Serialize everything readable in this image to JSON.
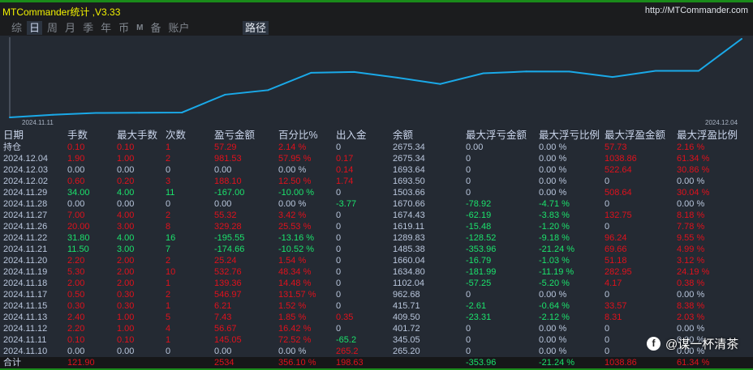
{
  "app": {
    "title": "MTCommander统计 ,V3.33",
    "url": "http://MTCommander.com"
  },
  "tabs": [
    {
      "label": "综",
      "selected": false
    },
    {
      "label": "日",
      "selected": true
    },
    {
      "label": "周",
      "selected": false
    },
    {
      "label": "月",
      "selected": false
    },
    {
      "label": "季",
      "selected": false
    },
    {
      "label": "年",
      "selected": false
    },
    {
      "label": "币",
      "selected": false
    },
    {
      "label": "M",
      "selected": false
    },
    {
      "label": "备",
      "selected": false
    },
    {
      "label": "账户",
      "selected": false
    }
  ],
  "path_button": "路径",
  "chart_data": {
    "type": "line",
    "x_start_label": "2024.11.11",
    "x_end_label": "2024.12.04",
    "line_color": "#1aa9e8",
    "x": [
      "2024.11.10",
      "2024.11.11",
      "2024.11.12",
      "2024.11.13",
      "2024.11.15",
      "2024.11.17",
      "2024.11.18",
      "2024.11.19",
      "2024.11.20",
      "2024.11.21",
      "2024.11.22",
      "2024.11.26",
      "2024.11.27",
      "2024.11.28",
      "2024.11.29",
      "2024.12.02",
      "2024.12.03",
      "2024.12.04"
    ],
    "values": [
      265.2,
      345.05,
      401.72,
      409.5,
      415.71,
      962.68,
      1102.04,
      1634.8,
      1660.04,
      1485.38,
      1289.83,
      1619.11,
      1674.43,
      1670.66,
      1503.66,
      1693.5,
      1693.64,
      2675.34
    ]
  },
  "colors": {
    "red": "#e0111c",
    "green": "#1be36c",
    "neutral": "#b9c6dc"
  },
  "table": {
    "headers": [
      "日期",
      "手数",
      "最大手数",
      "次数",
      "盈亏金额",
      "百分比%",
      "出入金",
      "余额",
      "最大浮亏金额",
      "最大浮亏比例",
      "最大浮盈金额",
      "最大浮盈比例"
    ],
    "rows": [
      {
        "c": "wrrrrrnnnnrr",
        "v": [
          "持仓",
          "0.10",
          "0.10",
          "1",
          "57.29",
          "2.14 %",
          "0",
          "2675.34",
          "0.00",
          "0.00 %",
          "57.73",
          "2.16 %"
        ]
      },
      {
        "c": "nrrrrrrnnnrr",
        "v": [
          "2024.12.04",
          "1.90",
          "1.00",
          "2",
          "981.53",
          "57.95 %",
          "0.17",
          "2675.34",
          "0",
          "0.00 %",
          "1038.86",
          "61.34 %"
        ]
      },
      {
        "c": "nnnnnnrnnnrr",
        "v": [
          "2024.12.03",
          "0.00",
          "0.00",
          "0",
          "0.00",
          "0.00 %",
          "0.14",
          "1693.64",
          "0",
          "0.00 %",
          "522.64",
          "30.86 %"
        ]
      },
      {
        "c": "nrrrrrrnnnnn",
        "v": [
          "2024.12.02",
          "0.60",
          "0.20",
          "3",
          "188.10",
          "12.50 %",
          "1.74",
          "1693.50",
          "0",
          "0.00 %",
          "0",
          "0.00 %"
        ]
      },
      {
        "c": "nggggg nnnnrr",
        "v": [
          "2024.11.29",
          "34.00",
          "4.00",
          "11",
          "-167.00",
          "-10.00 %",
          "0",
          "1503.66",
          "0",
          "0.00 %",
          "508.64",
          "30.04 %"
        ]
      },
      {
        "c": "nnnnnngnggnn",
        "v": [
          "2024.11.28",
          "0.00",
          "0.00",
          "0",
          "0.00",
          "0.00 %",
          "-3.77",
          "1670.66",
          "-78.92",
          "-4.71 %",
          "0",
          "0.00 %"
        ]
      },
      {
        "c": "nrrrrrnnggrr",
        "v": [
          "2024.11.27",
          "7.00",
          "4.00",
          "2",
          "55.32",
          "3.42 %",
          "0",
          "1674.43",
          "-62.19",
          "-3.83 %",
          "132.75",
          "8.18 %"
        ]
      },
      {
        "c": "nrrrrrnnggnr",
        "v": [
          "2024.11.26",
          "20.00",
          "3.00",
          "8",
          "329.28",
          "25.53 %",
          "0",
          "1619.11",
          "-15.48",
          "-1.20 %",
          "0",
          "7.78 %"
        ]
      },
      {
        "c": "ngggggnnggrr",
        "v": [
          "2024.11.22",
          "31.80",
          "4.00",
          "16",
          "-195.55",
          "-13.16 %",
          "0",
          "1289.83",
          "-128.52",
          "-9.18 %",
          "96.24",
          "9.55 %"
        ]
      },
      {
        "c": "ngggggnnggrr",
        "v": [
          "2024.11.21",
          "11.50",
          "3.00",
          "7",
          "-174.66",
          "-10.52 %",
          "0",
          "1485.38",
          "-353.96",
          "-21.24 %",
          "69.66",
          "4.99 %"
        ]
      },
      {
        "c": "nrrrrrnnggrr",
        "v": [
          "2024.11.20",
          "2.20",
          "2.00",
          "2",
          "25.24",
          "1.54 %",
          "0",
          "1660.04",
          "-16.79",
          "-1.03 %",
          "51.18",
          "3.12 %"
        ]
      },
      {
        "c": "nrrrrrnnggrr",
        "v": [
          "2024.11.19",
          "5.30",
          "2.00",
          "10",
          "532.76",
          "48.34 %",
          "0",
          "1634.80",
          "-181.99",
          "-11.19 %",
          "282.95",
          "24.19 %"
        ]
      },
      {
        "c": "nrrrrrnnggrr",
        "v": [
          "2024.11.18",
          "2.00",
          "2.00",
          "1",
          "139.36",
          "14.48 %",
          "0",
          "1102.04",
          "-57.25",
          "-5.20 %",
          "4.17",
          "0.38 %"
        ]
      },
      {
        "c": "nrrrrrnnnnnn",
        "v": [
          "2024.11.17",
          "0.50",
          "0.30",
          "2",
          "546.97",
          "131.57 %",
          "0",
          "962.68",
          "0",
          "0.00 %",
          "0",
          "0.00 %"
        ]
      },
      {
        "c": "nrrrrrnnggrr",
        "v": [
          "2024.11.15",
          "0.30",
          "0.30",
          "1",
          "6.21",
          "1.52 %",
          "0",
          "415.71",
          "-2.61",
          "-0.64 %",
          "33.57",
          "8.38 %"
        ]
      },
      {
        "c": "nrrrrrrnggrr",
        "v": [
          "2024.11.13",
          "2.40",
          "1.00",
          "5",
          "7.43",
          "1.85 %",
          "0.35",
          "409.50",
          "-23.31",
          "-2.12 %",
          "8.31",
          "2.03 %"
        ]
      },
      {
        "c": "nrrrrrnnnnnn",
        "v": [
          "2024.11.12",
          "2.20",
          "1.00",
          "4",
          "56.67",
          "16.42 %",
          "0",
          "401.72",
          "0",
          "0.00 %",
          "0",
          "0.00 %"
        ]
      },
      {
        "c": "nrrrrrgnnnnn",
        "v": [
          "2024.11.11",
          "0.10",
          "0.10",
          "1",
          "145.05",
          "72.52 %",
          "-65.2",
          "345.05",
          "0",
          "0.00 %",
          "0",
          "0.00 %"
        ]
      },
      {
        "c": "nnnnnnrnnnnn",
        "v": [
          "2024.11.10",
          "0.00",
          "0.00",
          "0",
          "0.00",
          "0.00 %",
          "265.2",
          "265.20",
          "0",
          "0.00 %",
          "0",
          "0.00 %"
        ]
      }
    ],
    "total": {
      "c": "wrnnrrrnggrr",
      "v": [
        "合计",
        "121.90",
        "",
        "",
        "2534",
        "356.10 %",
        "198.63",
        "",
        "-353.96",
        "-21.24 %",
        "1038.86",
        "61.34 %"
      ]
    }
  },
  "watermark": "@谋一杯清茶"
}
